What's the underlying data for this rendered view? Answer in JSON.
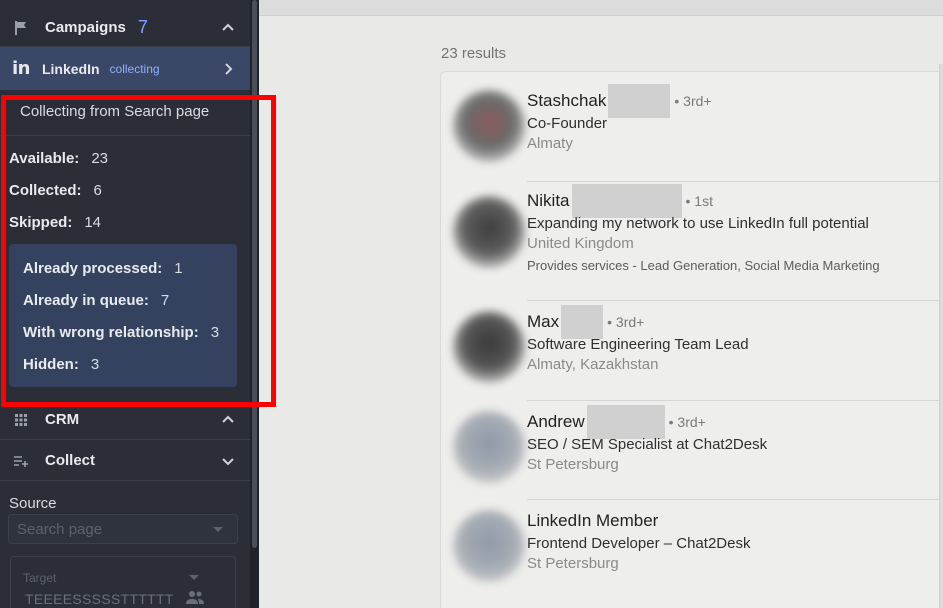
{
  "sidebar": {
    "campaigns": {
      "title": "Campaigns",
      "count": "7"
    },
    "linkedin": {
      "logo": "in",
      "title": "LinkedIn",
      "status": "collecting"
    },
    "collecting_from": "Collecting from Search page",
    "stats": [
      {
        "label": "Available:",
        "value": "23"
      },
      {
        "label": "Collected:",
        "value": "6"
      },
      {
        "label": "Skipped:",
        "value": "14"
      }
    ],
    "skipped_breakdown": [
      {
        "label": "Already processed:",
        "value": "1"
      },
      {
        "label": "Already in queue:",
        "value": "7"
      },
      {
        "label": "With wrong relationship:",
        "value": "3"
      },
      {
        "label": "Hidden:",
        "value": "3"
      }
    ],
    "crm": {
      "title": "CRM"
    },
    "collect": {
      "title": "Collect"
    },
    "source": {
      "label": "Source",
      "value": "Search page"
    },
    "target": {
      "label": "Target",
      "value": "TEEEESSSSSTTTTTT"
    }
  },
  "main": {
    "results_count": "23 results",
    "results": [
      {
        "name": "Stashchak",
        "degree": "• 3rd+",
        "headline": "Co-Founder",
        "location": "Almaty",
        "services": ""
      },
      {
        "name": "Nikita",
        "degree": "• 1st",
        "headline": "Expanding my network to use LinkedIn full potential",
        "location": "United Kingdom",
        "services": "Provides services - Lead Generation, Social Media Marketing"
      },
      {
        "name": "Max",
        "degree": "• 3rd+",
        "headline": "Software Engineering Team Lead",
        "location": "Almaty, Kazakhstan",
        "services": ""
      },
      {
        "name": "Andrew",
        "degree": "• 3rd+",
        "headline": "SEO / SEM Specialist at Chat2Desk",
        "location": "St Petersburg",
        "services": ""
      },
      {
        "name": "LinkedIn Member",
        "degree": "",
        "headline": "Frontend Developer – Chat2Desk",
        "location": "St Petersburg",
        "services": ""
      }
    ]
  },
  "colors": {
    "sidebar_bg": "#2b2e36",
    "linkedin_row_bg": "#3b4766",
    "accent": "#7fa0ff",
    "highlight": "#ff0000"
  },
  "icons": [
    "flag-icon",
    "linkedin-icon",
    "chevron-right-icon",
    "chevron-up-icon",
    "chevron-down-icon",
    "grid-icon",
    "playlist-add-icon",
    "people-icon"
  ]
}
